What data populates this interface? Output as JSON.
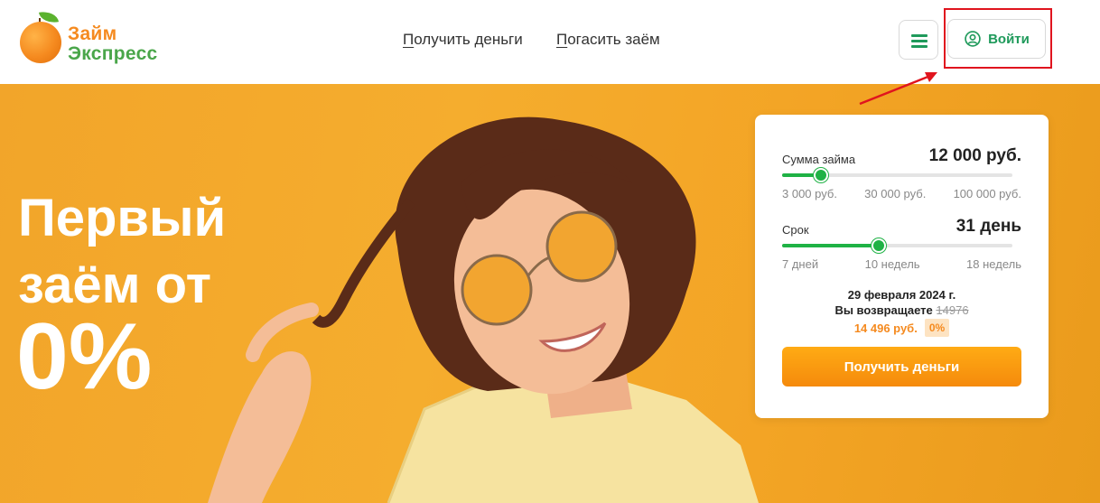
{
  "brand": {
    "line1": "Займ",
    "line2": "Экспресс"
  },
  "header": {
    "nav": [
      {
        "first": "П",
        "rest": "олучить деньги"
      },
      {
        "first": "П",
        "rest": "огасить заём"
      }
    ],
    "login_label": "Войти"
  },
  "hero": {
    "title_line1": "Первый",
    "title_line2": "заём от",
    "rate": "0%"
  },
  "calculator": {
    "amount": {
      "label": "Сумма займа",
      "value": "12 000 руб.",
      "level": 0.17,
      "ticks": [
        "3 000 руб.",
        "30 000 руб.",
        "100 000 руб."
      ]
    },
    "term": {
      "label": "Срок",
      "value": "31 день",
      "level": 0.42,
      "ticks": [
        "7 дней",
        "10 недель",
        "18 недель"
      ]
    },
    "date": "29 февраля 2024 г.",
    "return_label": "Вы возвращаете",
    "return_old": "14976",
    "return_new": "14 496 руб.",
    "discount_badge": "0%",
    "cta": "Получить деньги"
  },
  "colors": {
    "accent_orange": "#f58a1f",
    "accent_green": "#1f9a5b",
    "slider_green": "#1fb245",
    "highlight_red": "#e0141e",
    "hero_bg": "#f5ad2e"
  }
}
